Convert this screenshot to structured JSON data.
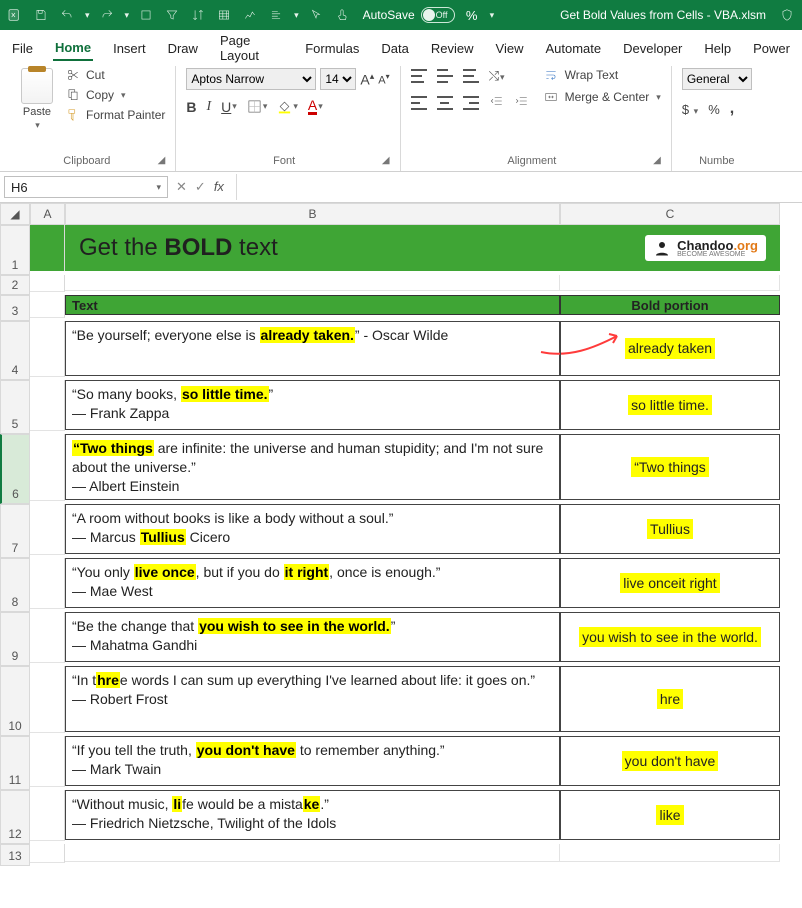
{
  "titlebar": {
    "autosave_label": "AutoSave",
    "autosave_state": "Off",
    "percent": "%",
    "doc_title": "Get Bold Values from Cells - VBA.xlsm"
  },
  "menu": {
    "items": [
      "File",
      "Home",
      "Insert",
      "Draw",
      "Page Layout",
      "Formulas",
      "Data",
      "Review",
      "View",
      "Automate",
      "Developer",
      "Help",
      "Power"
    ],
    "active": "Home"
  },
  "ribbon": {
    "clipboard": {
      "paste": "Paste",
      "cut": "Cut",
      "copy": "Copy",
      "format_painter": "Format Painter",
      "label": "Clipboard"
    },
    "font": {
      "name": "Aptos Narrow",
      "size": "14",
      "label": "Font"
    },
    "alignment": {
      "wrap": "Wrap Text",
      "merge": "Merge & Center",
      "label": "Alignment"
    },
    "number": {
      "format": "General",
      "label": "Numbe"
    }
  },
  "formula_bar": {
    "cell_ref": "H6",
    "fx": "fx"
  },
  "columns": [
    "A",
    "B",
    "C"
  ],
  "row_numbers": [
    "1",
    "2",
    "3",
    "4",
    "5",
    "6",
    "7",
    "8",
    "9",
    "10",
    "11",
    "12",
    "13"
  ],
  "banner": {
    "pre": "Get the ",
    "bold": "BOLD",
    "post": " text",
    "brand": "Chandoo",
    "brand_suffix": ".org",
    "brand_sub": "BECOME AWESOME"
  },
  "table": {
    "header_b": "Text",
    "header_c": "Bold portion",
    "rows": [
      {
        "pre": "“Be yourself; everyone else is ",
        "bold": "already taken.",
        "post": "” - Oscar Wilde",
        "c": "already taken",
        "h": 55,
        "arrow": true
      },
      {
        "pre": "“So many books, ",
        "bold": "so little time.",
        "post": "”",
        "author": "― Frank Zappa",
        "c": "so little time.",
        "h": 50
      },
      {
        "pre": "",
        "bold": "“Two things",
        "post": " are infinite: the universe and human stupidity; and I'm not sure about the universe.”",
        "author": "― Albert Einstein",
        "c": "“Two things",
        "h": 66
      },
      {
        "pre": "“A room without books is like a body without a soul.”",
        "author_pre": "― Marcus ",
        "author_bold": "Tullius",
        "author_post": " Cicero",
        "c": "Tullius",
        "h": 50
      },
      {
        "pre": "“You only ",
        "bold": "live once",
        "mid": ", but if you do ",
        "bold2": "it right",
        "post": ", once is enough.”",
        "author": "― Mae West",
        "c": "live onceit right",
        "h": 50
      },
      {
        "pre": "“Be the change that ",
        "bold": "you wish to see in the world.",
        "post": "”",
        "author": "― Mahatma Gandhi",
        "c": "you wish to see in the world.",
        "h": 50
      },
      {
        "pre": "“In t",
        "bold": "hre",
        "post": "e words I can sum up everything I've learned about life: it goes on.”",
        "author": "― Robert Frost",
        "c": "hre",
        "h": 66
      },
      {
        "pre": "“If you tell the truth, ",
        "bold": "you don't have",
        "post": " to remember anything.”",
        "author": "― Mark Twain",
        "c": "you don't have",
        "h": 50
      },
      {
        "pre": "“Without music, ",
        "bold": "li",
        "mid": "fe would be a mista",
        "bold2": "ke",
        "post": ".”",
        "author": "― Friedrich Nietzsche, Twilight of the Idols",
        "c": "like",
        "h": 50
      }
    ]
  }
}
